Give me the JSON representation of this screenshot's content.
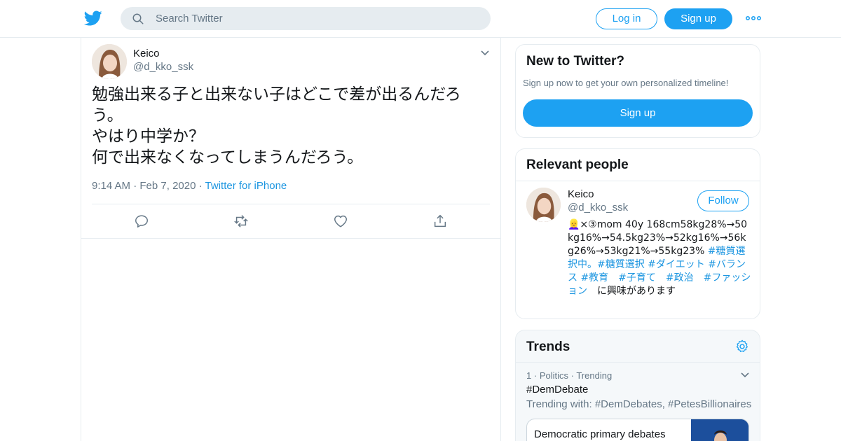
{
  "header": {
    "search_placeholder": "Search Twitter",
    "login_label": "Log in",
    "signup_label": "Sign up",
    "brand_color": "#1da1f2"
  },
  "tweet": {
    "name": "Keico",
    "handle": "@d_kko_ssk",
    "text": "勉強出来る子と出来ない子はどこで差が出るんだろう。\nやはり中学か？\n何で出来なくなってしまうんだろう。",
    "time": "9:14 AM",
    "date": "Feb 7, 2020",
    "source": "Twitter for iPhone"
  },
  "sidebar": {
    "new_to_twitter": {
      "title": "New to Twitter?",
      "subtitle": "Sign up now to get your own personalized timeline!",
      "signup_label": "Sign up"
    },
    "relevant_people": {
      "title": "Relevant people",
      "person": {
        "name": "Keico",
        "handle": "@d_kko_ssk",
        "follow_label": "Follow",
        "bio_prefix": "👱‍♀️×③mom 40y 168cm58kg28%→50kg16%→54.5kg23%→52kg16%→56kg26%→53kg21%→55kg23% ",
        "bio_tags": "#糖質選択中。#糖質選択 #ダイエット #バランス #教育　#子育て　#政治　#ファッション",
        "bio_suffix": "　に興味があります"
      }
    },
    "trends": {
      "title": "Trends",
      "items": [
        {
          "rank": "1",
          "category": "Politics",
          "status": "Trending",
          "name": "#DemDebate",
          "trending_with": "Trending with: #DemDebates, #PetesBillionaires",
          "news_title": "Democratic primary debates"
        }
      ]
    }
  }
}
